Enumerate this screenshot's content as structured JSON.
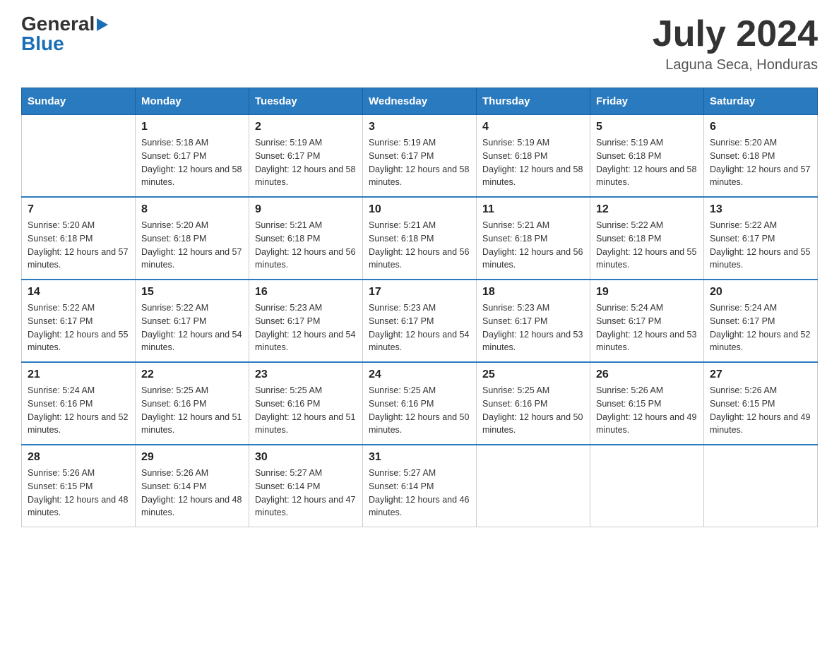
{
  "header": {
    "logo_general": "General",
    "logo_blue": "Blue",
    "title": "July 2024",
    "location": "Laguna Seca, Honduras"
  },
  "weekdays": [
    "Sunday",
    "Monday",
    "Tuesday",
    "Wednesday",
    "Thursday",
    "Friday",
    "Saturday"
  ],
  "weeks": [
    [
      {
        "day": "",
        "sunrise": "",
        "sunset": "",
        "daylight": ""
      },
      {
        "day": "1",
        "sunrise": "Sunrise: 5:18 AM",
        "sunset": "Sunset: 6:17 PM",
        "daylight": "Daylight: 12 hours and 58 minutes."
      },
      {
        "day": "2",
        "sunrise": "Sunrise: 5:19 AM",
        "sunset": "Sunset: 6:17 PM",
        "daylight": "Daylight: 12 hours and 58 minutes."
      },
      {
        "day": "3",
        "sunrise": "Sunrise: 5:19 AM",
        "sunset": "Sunset: 6:17 PM",
        "daylight": "Daylight: 12 hours and 58 minutes."
      },
      {
        "day": "4",
        "sunrise": "Sunrise: 5:19 AM",
        "sunset": "Sunset: 6:18 PM",
        "daylight": "Daylight: 12 hours and 58 minutes."
      },
      {
        "day": "5",
        "sunrise": "Sunrise: 5:19 AM",
        "sunset": "Sunset: 6:18 PM",
        "daylight": "Daylight: 12 hours and 58 minutes."
      },
      {
        "day": "6",
        "sunrise": "Sunrise: 5:20 AM",
        "sunset": "Sunset: 6:18 PM",
        "daylight": "Daylight: 12 hours and 57 minutes."
      }
    ],
    [
      {
        "day": "7",
        "sunrise": "Sunrise: 5:20 AM",
        "sunset": "Sunset: 6:18 PM",
        "daylight": "Daylight: 12 hours and 57 minutes."
      },
      {
        "day": "8",
        "sunrise": "Sunrise: 5:20 AM",
        "sunset": "Sunset: 6:18 PM",
        "daylight": "Daylight: 12 hours and 57 minutes."
      },
      {
        "day": "9",
        "sunrise": "Sunrise: 5:21 AM",
        "sunset": "Sunset: 6:18 PM",
        "daylight": "Daylight: 12 hours and 56 minutes."
      },
      {
        "day": "10",
        "sunrise": "Sunrise: 5:21 AM",
        "sunset": "Sunset: 6:18 PM",
        "daylight": "Daylight: 12 hours and 56 minutes."
      },
      {
        "day": "11",
        "sunrise": "Sunrise: 5:21 AM",
        "sunset": "Sunset: 6:18 PM",
        "daylight": "Daylight: 12 hours and 56 minutes."
      },
      {
        "day": "12",
        "sunrise": "Sunrise: 5:22 AM",
        "sunset": "Sunset: 6:18 PM",
        "daylight": "Daylight: 12 hours and 55 minutes."
      },
      {
        "day": "13",
        "sunrise": "Sunrise: 5:22 AM",
        "sunset": "Sunset: 6:17 PM",
        "daylight": "Daylight: 12 hours and 55 minutes."
      }
    ],
    [
      {
        "day": "14",
        "sunrise": "Sunrise: 5:22 AM",
        "sunset": "Sunset: 6:17 PM",
        "daylight": "Daylight: 12 hours and 55 minutes."
      },
      {
        "day": "15",
        "sunrise": "Sunrise: 5:22 AM",
        "sunset": "Sunset: 6:17 PM",
        "daylight": "Daylight: 12 hours and 54 minutes."
      },
      {
        "day": "16",
        "sunrise": "Sunrise: 5:23 AM",
        "sunset": "Sunset: 6:17 PM",
        "daylight": "Daylight: 12 hours and 54 minutes."
      },
      {
        "day": "17",
        "sunrise": "Sunrise: 5:23 AM",
        "sunset": "Sunset: 6:17 PM",
        "daylight": "Daylight: 12 hours and 54 minutes."
      },
      {
        "day": "18",
        "sunrise": "Sunrise: 5:23 AM",
        "sunset": "Sunset: 6:17 PM",
        "daylight": "Daylight: 12 hours and 53 minutes."
      },
      {
        "day": "19",
        "sunrise": "Sunrise: 5:24 AM",
        "sunset": "Sunset: 6:17 PM",
        "daylight": "Daylight: 12 hours and 53 minutes."
      },
      {
        "day": "20",
        "sunrise": "Sunrise: 5:24 AM",
        "sunset": "Sunset: 6:17 PM",
        "daylight": "Daylight: 12 hours and 52 minutes."
      }
    ],
    [
      {
        "day": "21",
        "sunrise": "Sunrise: 5:24 AM",
        "sunset": "Sunset: 6:16 PM",
        "daylight": "Daylight: 12 hours and 52 minutes."
      },
      {
        "day": "22",
        "sunrise": "Sunrise: 5:25 AM",
        "sunset": "Sunset: 6:16 PM",
        "daylight": "Daylight: 12 hours and 51 minutes."
      },
      {
        "day": "23",
        "sunrise": "Sunrise: 5:25 AM",
        "sunset": "Sunset: 6:16 PM",
        "daylight": "Daylight: 12 hours and 51 minutes."
      },
      {
        "day": "24",
        "sunrise": "Sunrise: 5:25 AM",
        "sunset": "Sunset: 6:16 PM",
        "daylight": "Daylight: 12 hours and 50 minutes."
      },
      {
        "day": "25",
        "sunrise": "Sunrise: 5:25 AM",
        "sunset": "Sunset: 6:16 PM",
        "daylight": "Daylight: 12 hours and 50 minutes."
      },
      {
        "day": "26",
        "sunrise": "Sunrise: 5:26 AM",
        "sunset": "Sunset: 6:15 PM",
        "daylight": "Daylight: 12 hours and 49 minutes."
      },
      {
        "day": "27",
        "sunrise": "Sunrise: 5:26 AM",
        "sunset": "Sunset: 6:15 PM",
        "daylight": "Daylight: 12 hours and 49 minutes."
      }
    ],
    [
      {
        "day": "28",
        "sunrise": "Sunrise: 5:26 AM",
        "sunset": "Sunset: 6:15 PM",
        "daylight": "Daylight: 12 hours and 48 minutes."
      },
      {
        "day": "29",
        "sunrise": "Sunrise: 5:26 AM",
        "sunset": "Sunset: 6:14 PM",
        "daylight": "Daylight: 12 hours and 48 minutes."
      },
      {
        "day": "30",
        "sunrise": "Sunrise: 5:27 AM",
        "sunset": "Sunset: 6:14 PM",
        "daylight": "Daylight: 12 hours and 47 minutes."
      },
      {
        "day": "31",
        "sunrise": "Sunrise: 5:27 AM",
        "sunset": "Sunset: 6:14 PM",
        "daylight": "Daylight: 12 hours and 46 minutes."
      },
      {
        "day": "",
        "sunrise": "",
        "sunset": "",
        "daylight": ""
      },
      {
        "day": "",
        "sunrise": "",
        "sunset": "",
        "daylight": ""
      },
      {
        "day": "",
        "sunrise": "",
        "sunset": "",
        "daylight": ""
      }
    ]
  ]
}
